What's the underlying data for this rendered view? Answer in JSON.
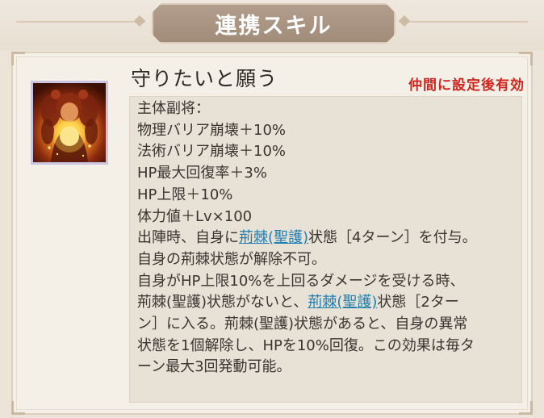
{
  "header": {
    "title": "連携スキル"
  },
  "skill": {
    "name": "守りたいと願う",
    "condition": "仲間に設定後有効",
    "icon": "praying-girl-light-icon"
  },
  "description": {
    "target": "主体副将：",
    "buff_1": "物理バリア崩壊＋10%",
    "buff_2": "法術バリア崩壊＋10%",
    "buff_3": "HP最大回復率＋3%",
    "buff_4": "HP上限＋10%",
    "buff_5": "体力値＋Lv×100",
    "line6_pre": "出陣時、自身に",
    "line6_link": "荊棘(聖護)",
    "line6_post": "状態［4ターン］を付与。",
    "line7": "自身の荊棘状態が解除不可。",
    "line8": "自身がHP上限10%を上回るダメージを受ける時、",
    "line9_pre": "荊棘(聖護)状態がないと、",
    "line9_link": "荊棘(聖護)",
    "line9_post": "状態［2ター",
    "line10": "ン］に入る。荊棘(聖護)状態があると、自身の異常",
    "line11": "状態を1個解除し、HPを10%回復。この効果は毎タ",
    "line12": "ーン最大3回発動可能。"
  },
  "colors": {
    "banner": "#a8917f",
    "condition": "#d0261f",
    "link": "#1f7fb0",
    "text": "#3a3430"
  }
}
